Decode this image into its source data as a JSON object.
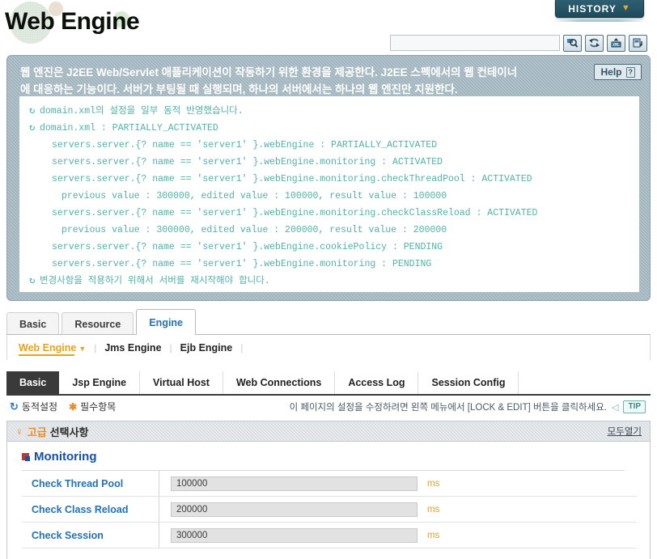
{
  "header": {
    "title": "Web Engine",
    "history_label": "HISTORY",
    "history_caret": "▼"
  },
  "toolbar": {
    "search_value": "",
    "search_placeholder": "",
    "buttons": [
      {
        "name": "search-icon",
        "title": "Search"
      },
      {
        "name": "refresh-icon",
        "title": "Refresh"
      },
      {
        "name": "xml-export-icon",
        "title": "XML"
      },
      {
        "name": "save-export-icon",
        "title": "Export"
      }
    ]
  },
  "banner": {
    "description_line1": "웹 엔진은 J2EE Web/Servlet 애플리케이션이 작동하기 위한 환경을 제공한다. J2EE 스펙에서의 웹 컨테이너",
    "description_line2": "에 대응하는 기능이다. 서버가 부팅될 때 실행되며, 하나의 서버에서는 하나의 웹 엔진만 지원한다.",
    "help_label": "Help",
    "help_icon": "?"
  },
  "log": {
    "icon": "↻",
    "lines": [
      {
        "icon": true,
        "indent": 1,
        "text": "domain.xml의 설정을 일부 동적 반영했습니다."
      },
      {
        "icon": true,
        "indent": 1,
        "text": "domain.xml : PARTIALLY_ACTIVATED"
      },
      {
        "icon": false,
        "indent": 2,
        "text": "servers.server.{? name == 'server1' }.webEngine : PARTIALLY_ACTIVATED"
      },
      {
        "icon": false,
        "indent": 2,
        "text": "servers.server.{? name == 'server1' }.webEngine.monitoring : ACTIVATED"
      },
      {
        "icon": false,
        "indent": 2,
        "text": "servers.server.{? name == 'server1' }.webEngine.monitoring.checkThreadPool : ACTIVATED"
      },
      {
        "icon": false,
        "indent": 3,
        "text": "previous value : 300000, edited value : 100000, result value : 100000"
      },
      {
        "icon": false,
        "indent": 2,
        "text": "servers.server.{? name == 'server1' }.webEngine.monitoring.checkClassReload : ACTIVATED"
      },
      {
        "icon": false,
        "indent": 3,
        "text": "previous value : 300000, edited value : 200000, result value : 200000"
      },
      {
        "icon": false,
        "indent": 2,
        "text": "servers.server.{? name == 'server1' }.webEngine.cookiePolicy : PENDING"
      },
      {
        "icon": false,
        "indent": 2,
        "text": "servers.server.{? name == 'server1' }.webEngine.monitoring : PENDING"
      },
      {
        "icon": true,
        "indent": 1,
        "text": "변경사항을 적용하기 위해서 서버를 재시작해야 합니다."
      }
    ]
  },
  "tabs": [
    {
      "label": "Basic",
      "active": false
    },
    {
      "label": "Resource",
      "active": false
    },
    {
      "label": "Engine",
      "active": true
    }
  ],
  "engine_nav": [
    {
      "label": "Web Engine",
      "active": true,
      "caret": "▼"
    },
    {
      "label": "Jms Engine",
      "active": false,
      "caret": ""
    },
    {
      "label": "Ejb Engine",
      "active": false,
      "caret": ""
    }
  ],
  "sub_tabs": [
    {
      "label": "Basic",
      "active": true
    },
    {
      "label": "Jsp Engine",
      "active": false
    },
    {
      "label": "Virtual Host",
      "active": false
    },
    {
      "label": "Web Connections",
      "active": false
    },
    {
      "label": "Access Log",
      "active": false
    },
    {
      "label": "Session Config",
      "active": false
    }
  ],
  "legend": {
    "dynamic_icon": "↻",
    "dynamic_label": "동적설정",
    "required_icon": "✱",
    "required_label": "필수항목",
    "notice_text": "이 페이지의 설정을 수정하려면 왼쪽 메뉴에서 [LOCK & EDIT] 버튼을 클릭하세요.",
    "tip_arrow": "◁",
    "tip_label": "TIP"
  },
  "advanced": {
    "bulb_icon": "♀",
    "label_accent": "고급",
    "label_rest": "선택사항",
    "open_all": "모두열기"
  },
  "section": {
    "title": "Monitoring",
    "rows": [
      {
        "label": "Check Thread Pool",
        "value": "100000",
        "unit": "ms"
      },
      {
        "label": "Check Class Reload",
        "value": "200000",
        "unit": "ms"
      },
      {
        "label": "Check Session",
        "value": "300000",
        "unit": "ms"
      }
    ]
  },
  "colors": {
    "accent_blue": "#2272b5",
    "accent_orange": "#e8a317",
    "banner_bg": "#9fb3bd",
    "log_text": "#4fb3a8",
    "history_bg": "#1d4b5c"
  }
}
